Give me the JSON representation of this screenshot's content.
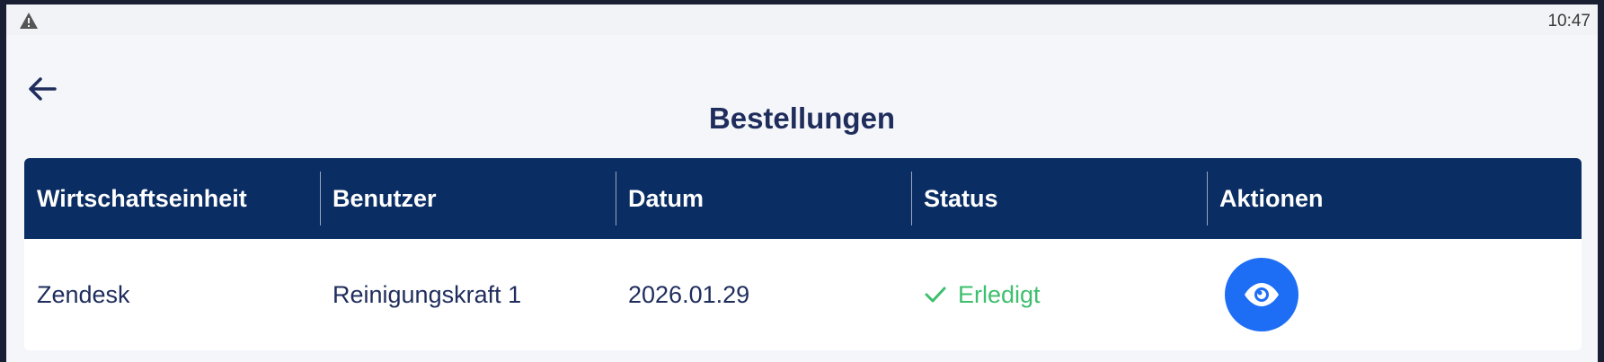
{
  "statusbar": {
    "time": "10:47",
    "icon": "warning-icon"
  },
  "header": {
    "back_icon": "arrow-left-icon",
    "title": "Bestellungen"
  },
  "table": {
    "columns": [
      "Wirtschaftseinheit",
      "Benutzer",
      "Datum",
      "Status",
      "Aktionen"
    ],
    "rows": [
      {
        "wirtschaftseinheit": "Zendesk",
        "benutzer": "Reinigungskraft 1",
        "datum": "2026.01.29",
        "status": "Erledigt",
        "status_icon": "check-icon",
        "action_icon": "eye-icon"
      }
    ]
  },
  "colors": {
    "header_bg": "#0a2d63",
    "accent": "#1e6ef5",
    "success": "#3dbf6e",
    "text": "#1f2d5c"
  }
}
